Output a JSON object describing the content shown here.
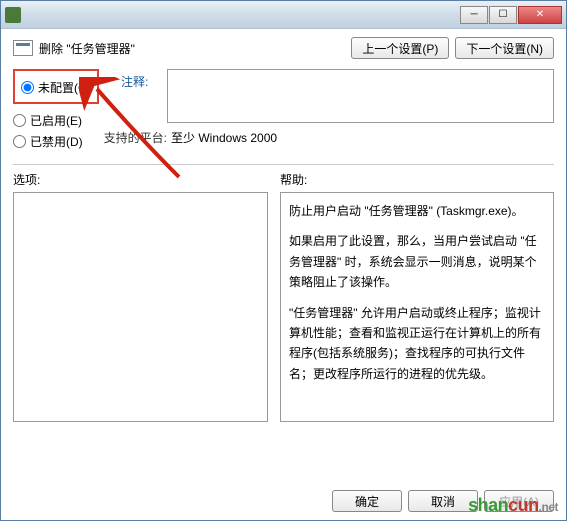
{
  "titlebar": {
    "text": ""
  },
  "header": {
    "title": "删除 \"任务管理器\"",
    "prev_btn": "上一个设置(P)",
    "next_btn": "下一个设置(N)"
  },
  "radios": {
    "not_configured": "未配置(C)",
    "enabled": "已启用(E)",
    "disabled": "已禁用(D)"
  },
  "comment_label": "注释:",
  "support": {
    "label": "支持的平台:",
    "value": "至少 Windows 2000"
  },
  "sections": {
    "options_label": "选项:",
    "help_label": "帮助:"
  },
  "help": {
    "p1": "防止用户启动 \"任务管理器\" (Taskmgr.exe)。",
    "p2": "如果启用了此设置，那么，当用户尝试启动 \"任务管理器\" 时，系统会显示一则消息，说明某个策略阻止了该操作。",
    "p3": "\"任务管理器\" 允许用户启动或终止程序；监视计算机性能；查看和监视正运行在计算机上的所有程序(包括系统服务)；查找程序的可执行文件名；更改程序所运行的进程的优先级。"
  },
  "footer": {
    "ok": "确定",
    "cancel": "取消",
    "apply": "应用(A)"
  },
  "watermark": {
    "shan": "shan",
    "cun": "cun",
    "net": ".net"
  }
}
